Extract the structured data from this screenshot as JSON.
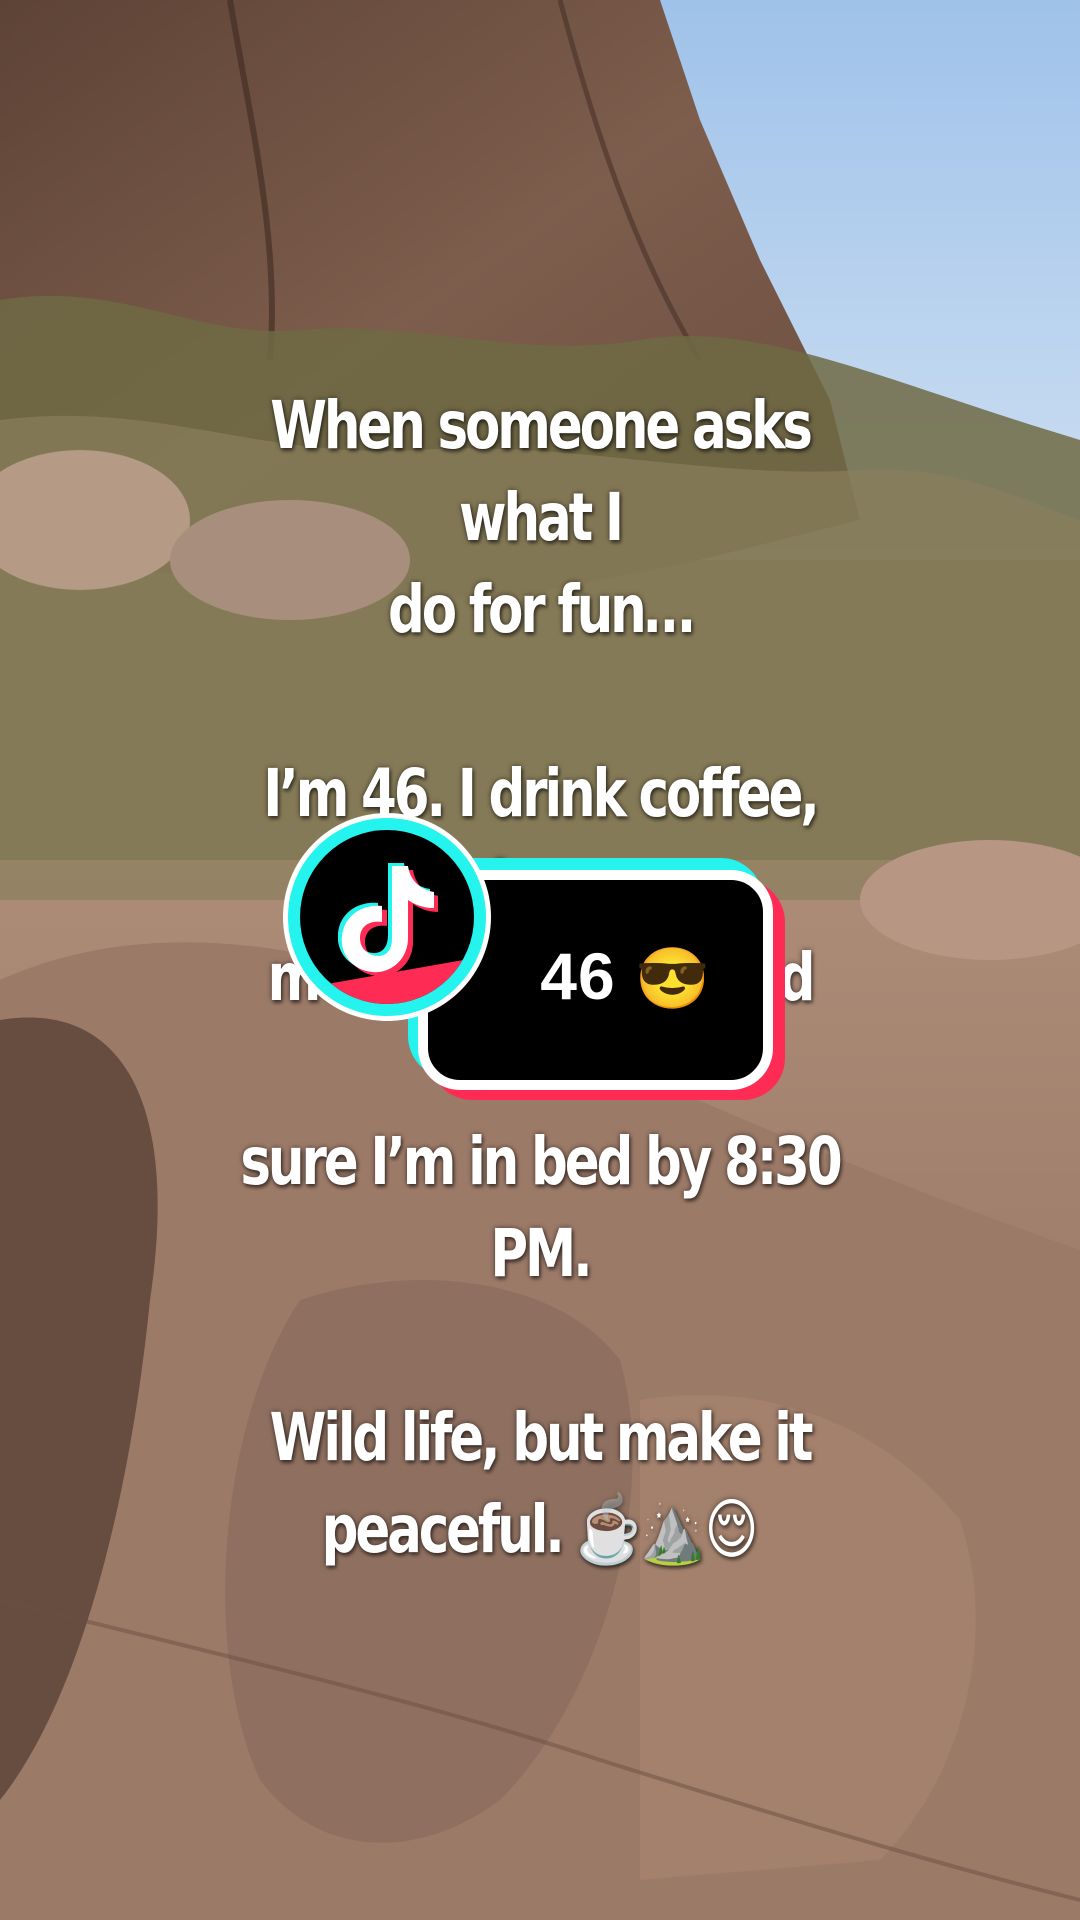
{
  "caption": {
    "line1": "When someone asks what I",
    "line2": "do for fun…",
    "line3": "I’m 46. I drink coffee, chase",
    "line4": "mountain views, and make",
    "line5": "sure I’m in bed by 8:30 PM.",
    "line6": "Wild life, but make it",
    "line7_text": "peaceful.",
    "line7_emoji": "☕️⛰️😌"
  },
  "badge": {
    "value": "46",
    "emoji": "😎",
    "logo_icon": "tiktok-logo-icon",
    "colors": {
      "cyan": "#25f4ee",
      "pink": "#fe2c55",
      "box": "#000000",
      "border": "#ffffff"
    }
  }
}
